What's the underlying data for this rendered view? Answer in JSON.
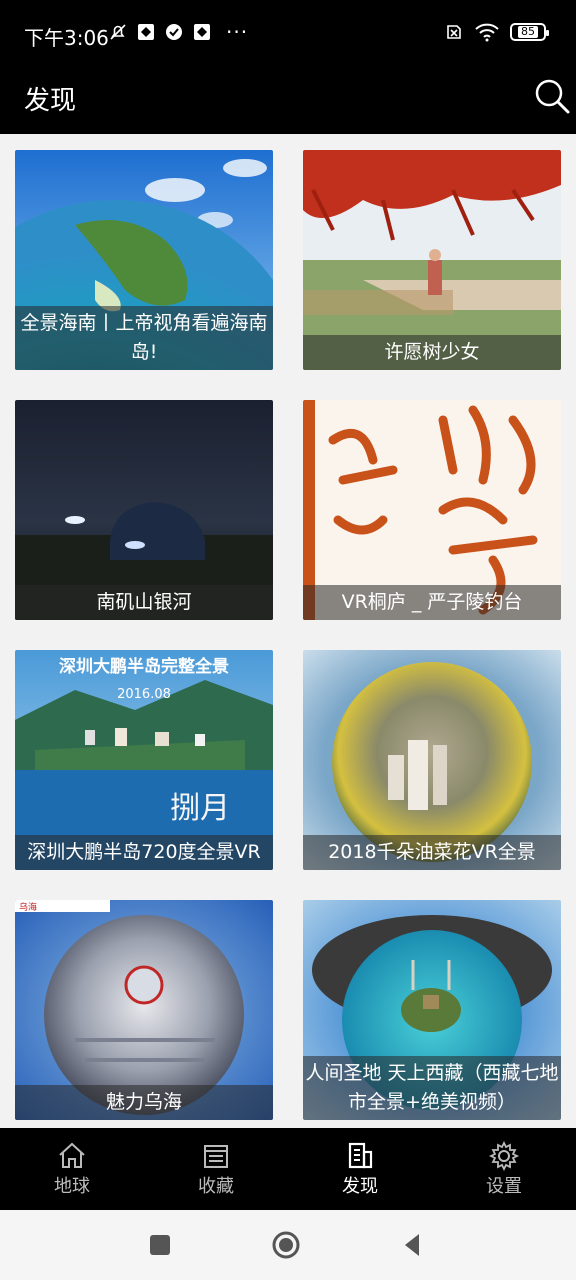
{
  "status_bar": {
    "time": "下午3:06",
    "dots": "···",
    "battery": "85"
  },
  "header": {
    "title": "发现",
    "search_icon": "search-icon"
  },
  "cards": [
    {
      "caption": "全景海南丨上帝视角看遍海南岛!"
    },
    {
      "caption": "许愿树少女"
    },
    {
      "caption": "南矶山银河"
    },
    {
      "caption": "VR桐庐 _ 严子陵钓台"
    },
    {
      "caption": "深圳大鹏半岛720度全景VR"
    },
    {
      "caption": "2018千朵油菜花VR全景"
    },
    {
      "caption": "魅力乌海"
    },
    {
      "caption": "人间圣地 天上西藏（西藏七地市全景+绝美视频）"
    }
  ],
  "card_image_text": {
    "shenzhen_banner": "深圳大鹏半岛完整全景",
    "shenzhen_date": "2016.08",
    "shenzhen_calligraphy": "捌月",
    "wuhai_banner": "乌海"
  },
  "bottom_nav": {
    "items": [
      {
        "label": "地球",
        "icon": "home-icon"
      },
      {
        "label": "收藏",
        "icon": "favorites-list-icon"
      },
      {
        "label": "发现",
        "icon": "discover-building-icon"
      },
      {
        "label": "设置",
        "icon": "gear-icon"
      }
    ],
    "active_index": 2
  },
  "colors": {
    "bar_background": "#000000",
    "content_background": "#f2f2f2",
    "caption_overlay": "rgba(40,40,40,0.55)"
  }
}
